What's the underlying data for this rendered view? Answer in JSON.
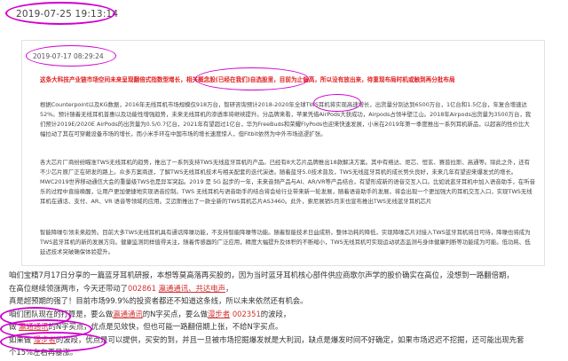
{
  "outer_timestamp": "2019-07-25 19:13:14",
  "card": {
    "timestamp": "2019-07-17 08:29:24",
    "headline": "这条大科技产业链市场空间未来呈现翻倍式指数型增长，相关概念股(已经在我们)自选股里，目前为止偏高，所以没有放出来，待重现布局时机或触到再分批布局",
    "paragraphs": [
      "根据Counterpoint以及KG数据，2016年无线耳机市场规模仅918万台，智研咨询预计2018-2020年全球TWS耳机将实现高速增长，出货量分别达到6500万台，1亿台和1.5亿台，年复合增速达52%。预计随着无线耳机普惠以及功能性增强趋势，未来无线耳机的渗透率将继续提升。分品牌来看，苹果凭借AirPods大获成功，Airpods占领半壁江山。2018年Airpods出货量为3500万台，我们预计2019E/2020E AirPods的出货量为0.5/0.7亿台，2021年有望超过1亿台，华为FreeBuds和荣耀FlyPods也迎来快速发展，小米在2019年第一季度推出一系列耳机新品，以超高的性价比大幅拉动了其在可穿戴设备市场的增长，而小米手环在中国市场的增长速度惊人，但Fitbit依然为中外市场巡逻扩张。",
      "各大芯片厂商纷纷瞄准TWS无线耳机的趋势，推出了一系列支持TWS无线蓝牙耳机的产品。已经有8大芯片品牌推出18款解决方案。其中有络达、炬芯、恒玄、赛普拉斯、高通等。除此之外，还有不少芯片原厂正在研发的路上。众多方案商逐，了解TWS无线耳机技术与相关配套的迭代演进。随着蓝牙5.0技术普及，TWS无线蓝牙耳机的成长势头良好，未来几年有望迎来爆发式的增长。MWC2019世界移动通信大会的重量级TWS也是异军突起。2019 是 5G 起步的一年，未来音频产品与AI、AR/VR等产品结合，有望形成新的语音交互入口。比如说蓝牙耳机中加入语音助手，在听音乐的过程中直接唤醒，让用户更加便捷地实现语音控制。TWS 无线耳机与语音助手的结合将会给行业带来新一轮发展，随着语音助手的发展，将会出现一个更加强大的耳机交互入口，实现TWS无线耳机在通话、支付、AR、VR 语音等领域的应用。艾迈斯推出了一款全新的TWS耳机芯片AS3460。此外，索尼展销5月末也宣布推出TWS无线蓝牙耳机芯片",
      "智能降噪引领未来趋势。目前大多TWS无线耳机具有通话降噪功能，不支持智能降噪等功能。随着智能技术日益成熟，整体功耗的降低，实现降噪芯片对接入TWS蓝牙耳机将日可待，降噪也将成为TWS蓝牙耳机的新的发展方向。健康监测同样值得关注，随着传感器的广泛应用，精度大幅提升及体积的不断缩小，TWS无线耳机可实现运动状态监测与身体健康判断等功能成为可能。低功耗、低延迟技术突破确保体验提升。"
    ]
  },
  "bottom": {
    "line1_a": "咱们宝精7月17日分享的一篇蓝牙耳机研报，本想等莫高落再买股的，因为当时蓝牙耳机核心部件供应商歌尔声学的股价确实在高位，没想到一路翻倍期，",
    "line2_a": "在高位继续领涨两市，今天还带动了",
    "stock1": "002861",
    "stock1_names": "瀛通通讯、共达电声",
    "line2_b": "，",
    "line3": "真是超预期的强了！目前市场99.9%的投资者都还不知道这条线，所以未来依然还有机会。",
    "line4": "咱们团队现在的打算是，要么做",
    "stock_a": "瀛通通讯",
    "line4_b": "的N字买点，要么做",
    "stock_b": "漫步者",
    "stock2": "002351",
    "line4_c": "的波段，",
    "line5_a": "做",
    "line5_b": "的N字买点，优点是见效快，但也可能一路翻倍期上张，不给N字买点。",
    "line6_a": "如果做",
    "line6_b": "的波段，优点是可以提供，买安的到，并且一旦被市场挖掘爆发就是大利润，缺点是爆发时间不好确定，如果市场迟迟不挖掘，还可能出现先套",
    "line7": "个15%左右再暴涨。"
  }
}
